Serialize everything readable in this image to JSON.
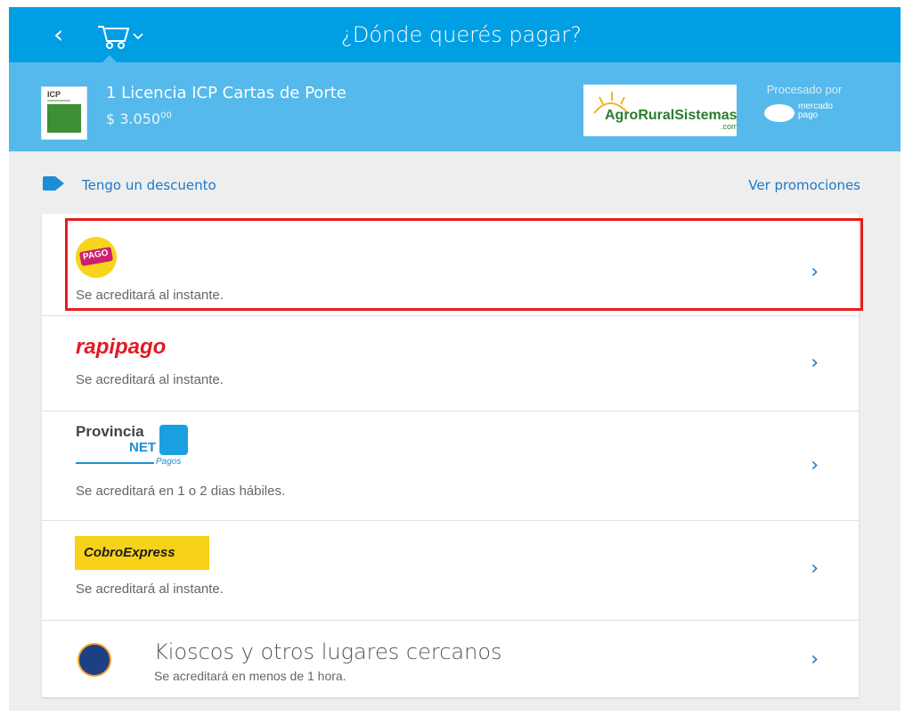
{
  "header": {
    "title": "¿Dónde querés pagar?",
    "back_icon": "chevron-left-icon",
    "cart_icon": "cart-icon",
    "chevron_icon": "chevron-down-icon"
  },
  "summary": {
    "item_name": "1 Licencia ICP Cartas de Porte",
    "price_main": "$ 3.050",
    "price_cents": "00",
    "product_thumb_text": "ICP",
    "seller_name": "AgroRuralSistemas",
    "seller_suffix": ".com",
    "processed_by": "Procesado por",
    "processor_name_top": "mercado",
    "processor_name_bottom": "pago"
  },
  "discount": {
    "label": "Tengo un descuento",
    "promos": "Ver promociones",
    "icon": "tag-icon"
  },
  "options": [
    {
      "logo_text": "PAGO",
      "desc": "Se acreditará al instante.",
      "highlighted": true
    },
    {
      "logo_text": "rapipago",
      "desc": "Se acreditará al instante."
    },
    {
      "logo_text_1": "Provincia",
      "logo_text_2": "NET",
      "logo_text_3": "Pagos",
      "desc": "Se acreditará en 1 o 2 dias hábiles."
    },
    {
      "logo_text": "CobroExpress",
      "desc": "Se acreditará al instante."
    },
    {
      "title": "Kioscos y otros lugares cercanos",
      "desc": "Se acreditará en menos de 1 hora."
    }
  ],
  "colors": {
    "topbar": "#009ee3",
    "summary": "#55b9eb",
    "link": "#1a79c9",
    "highlight": "#e61c1c"
  }
}
